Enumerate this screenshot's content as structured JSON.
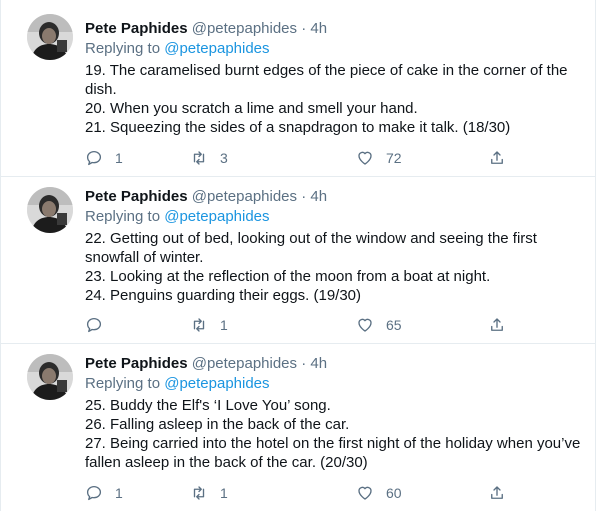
{
  "tweets": [
    {
      "name": "Pete Paphides",
      "handle": "@petepaphides",
      "separator": "·",
      "time": "4h",
      "replying_prefix": "Replying to ",
      "replying_to": "@petepaphides",
      "lines": [
        "19. The caramelised burnt edges of the piece of cake in the corner of the dish.",
        "20. When you scratch a lime and smell your hand.",
        "21. Squeezing the sides of a snapdragon to make it talk. (18/30)"
      ],
      "replies": "1",
      "retweets": "3",
      "likes": "72"
    },
    {
      "name": "Pete Paphides",
      "handle": "@petepaphides",
      "separator": "·",
      "time": "4h",
      "replying_prefix": "Replying to ",
      "replying_to": "@petepaphides",
      "lines": [
        "22. Getting out of bed, looking out of the window and seeing the first snowfall of winter.",
        "23. Looking at the reflection of the moon from a boat at night.",
        "24. Penguins guarding their eggs. (19/30)"
      ],
      "replies": "",
      "retweets": "1",
      "likes": "65"
    },
    {
      "name": "Pete Paphides",
      "handle": "@petepaphides",
      "separator": "·",
      "time": "4h",
      "replying_prefix": "Replying to ",
      "replying_to": "@petepaphides",
      "lines": [
        "25. Buddy the Elf's ‘I Love You’ song.",
        "26. Falling asleep in the back of the car.",
        "27. Being carried into the hotel on the first night of the holiday when you’ve fallen asleep in the back of the car. (20/30)"
      ],
      "replies": "1",
      "retweets": "1",
      "likes": "60"
    }
  ],
  "icons": {
    "avatar": "avatar-photo",
    "reply": "reply-icon",
    "retweet": "retweet-icon",
    "like": "like-icon",
    "share": "share-icon"
  },
  "colors": {
    "text": "#0f1419",
    "secondary": "#5b7083",
    "link": "#1b95e0",
    "border": "#e6ecf0"
  }
}
